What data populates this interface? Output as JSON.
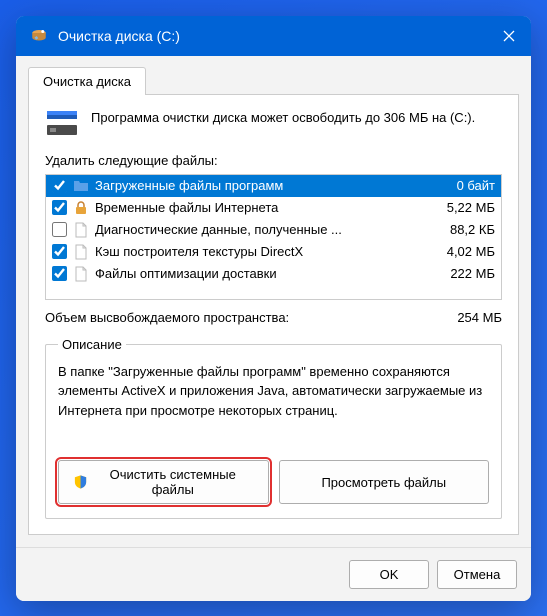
{
  "titlebar": {
    "title": "Очистка диска  (C:)"
  },
  "tab_label": "Очистка диска",
  "info_text": "Программа очистки диска может освободить до 306 МБ на (C:).",
  "section_label": "Удалить следующие файлы:",
  "files": [
    {
      "name": "Загруженные файлы программ",
      "size": "0 байт",
      "checked": true,
      "icon": "folder-blue",
      "selected": true
    },
    {
      "name": "Временные файлы Интернета",
      "size": "5,22 МБ",
      "checked": true,
      "icon": "lock",
      "selected": false
    },
    {
      "name": "Диагностические данные, полученные ...",
      "size": "88,2 КБ",
      "checked": false,
      "icon": "file",
      "selected": false
    },
    {
      "name": "Кэш построителя текстуры DirectX",
      "size": "4,02 МБ",
      "checked": true,
      "icon": "file",
      "selected": false
    },
    {
      "name": "Файлы оптимизации доставки",
      "size": "222 МБ",
      "checked": true,
      "icon": "file",
      "selected": false
    }
  ],
  "summary": {
    "label": "Объем высвобождаемого пространства:",
    "value": "254 МБ"
  },
  "description": {
    "legend": "Описание",
    "text": "В папке \"Загруженные файлы программ\" временно сохраняются элементы ActiveX и приложения Java, автоматически загружаемые из Интернета при просмотре некоторых страниц."
  },
  "buttons": {
    "clean_system": "Очистить системные файлы",
    "view_files": "Просмотреть файлы",
    "ok": "OK",
    "cancel": "Отмена"
  }
}
